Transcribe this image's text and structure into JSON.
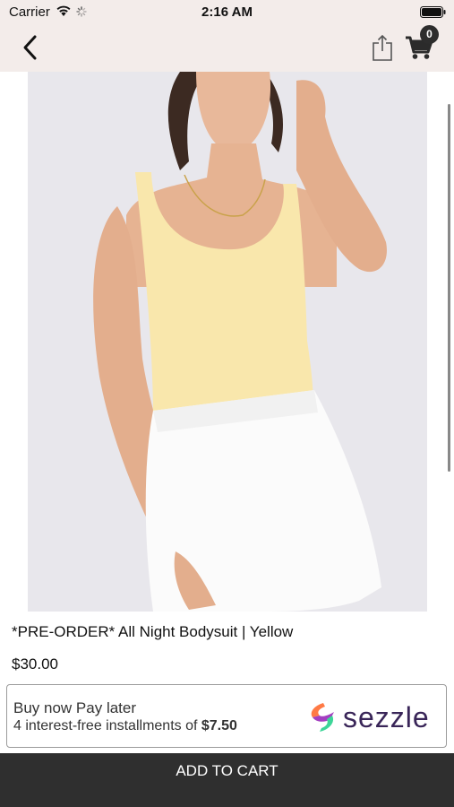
{
  "status_bar": {
    "carrier": "Carrier",
    "time": "2:16 AM"
  },
  "nav": {
    "back_icon": "chevron-left-icon",
    "share_icon": "share-icon",
    "cart_icon": "cart-icon",
    "cart_count": "0"
  },
  "product": {
    "image": "yellow bodysuit model photo",
    "title": "*PRE-ORDER* All Night Bodysuit | Yellow",
    "price": "$30.00",
    "image_count": 2,
    "active_image": 2
  },
  "sezzle": {
    "headline": "Buy now Pay later",
    "subline": "4 interest-free installments of ",
    "amount": "$7.50",
    "brand": "sezzle"
  },
  "actions": {
    "add_to_cart": "ADD TO CART"
  },
  "colors": {
    "nav_bg": "#f3ecea",
    "button_bg": "#2f2f2f",
    "sezzle_purple": "#392558"
  }
}
